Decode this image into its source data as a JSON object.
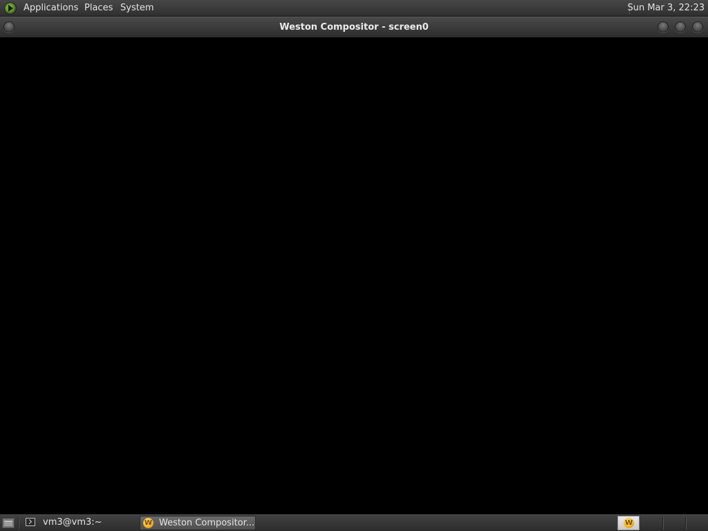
{
  "top_panel": {
    "menus": [
      "Applications",
      "Places",
      "System"
    ],
    "clock": "Sun Mar  3, 22:23"
  },
  "window": {
    "title": "Weston Compositor - screen0"
  },
  "taskbar": {
    "tasks": [
      {
        "label": "vm3@vm3:~",
        "icon": "terminal-icon",
        "active": false
      },
      {
        "label": "Weston Compositor...",
        "icon": "weston-icon",
        "active": true
      }
    ],
    "workspace_icon": "W"
  },
  "colors": {
    "panel": "#3a3a3a",
    "content": "#000000",
    "text": "#e4e4e4"
  }
}
